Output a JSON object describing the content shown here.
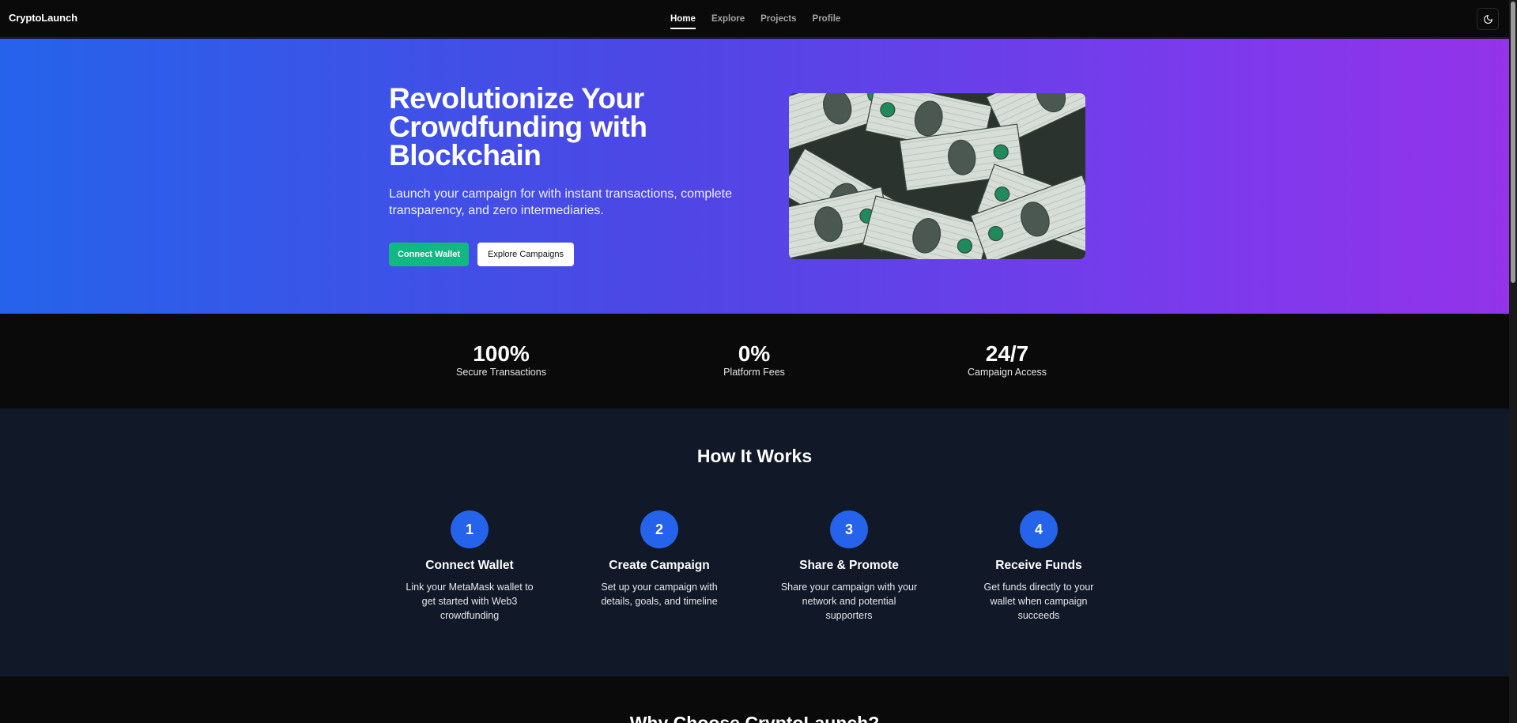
{
  "nav": {
    "brand": "CryptoLaunch",
    "links": [
      "Home",
      "Explore",
      "Projects",
      "Profile"
    ],
    "active": "Home",
    "theme_icon": "moon-icon"
  },
  "hero": {
    "title": "Revolutionize Your Crowdfunding with Blockchain",
    "subtitle": "Launch your campaign for with instant transactions, complete transparency, and zero intermediaries.",
    "connect_label": "Connect Wallet",
    "explore_label": "Explore Campaigns",
    "image_subject": "pile of US dollar bills"
  },
  "stats": [
    {
      "value": "100%",
      "label": "Secure Transactions"
    },
    {
      "value": "0%",
      "label": "Platform Fees"
    },
    {
      "value": "24/7",
      "label": "Campaign Access"
    }
  ],
  "how": {
    "title": "How It Works",
    "steps": [
      {
        "num": "1",
        "title": "Connect Wallet",
        "desc": "Link your MetaMask wallet to get started with Web3 crowdfunding"
      },
      {
        "num": "2",
        "title": "Create Campaign",
        "desc": "Set up your campaign with details, goals, and timeline"
      },
      {
        "num": "3",
        "title": "Share & Promote",
        "desc": "Share your campaign with your network and potential supporters"
      },
      {
        "num": "4",
        "title": "Receive Funds",
        "desc": "Get funds directly to your wallet when campaign succeeds"
      }
    ]
  },
  "why": {
    "title": "Why Choose CryptoLaunch?"
  },
  "colors": {
    "accent_blue": "#2563eb",
    "accent_purple": "#9333ea",
    "connect_green": "#10b981",
    "section_dark": "#111827"
  }
}
